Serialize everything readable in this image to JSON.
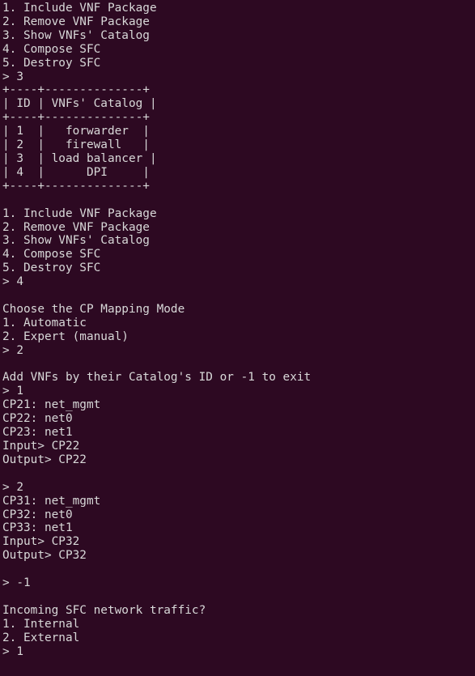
{
  "terminal": {
    "background_color": "#2d0922",
    "foreground_color": "#d8d8d8",
    "prompt_symbol": ">",
    "menu": {
      "items": [
        "1. Include VNF Package",
        "2. Remove VNF Package",
        "3. Show VNFs' Catalog",
        "4. Compose SFC",
        "5. Destroy SFC"
      ]
    },
    "catalog_table": {
      "border": "+----+--------------+",
      "header": "| ID | VNFs' Catalog |",
      "columns": [
        "ID",
        "VNFs' Catalog"
      ],
      "rows": [
        {
          "id": "1",
          "name": "forwarder"
        },
        {
          "id": "2",
          "name": "firewall"
        },
        {
          "id": "3",
          "name": "load balancer"
        },
        {
          "id": "4",
          "name": "DPI"
        }
      ]
    },
    "cp_mapping": {
      "prompt": "Choose the CP Mapping Mode",
      "options": [
        "1. Automatic",
        "2. Expert (manual)"
      ],
      "selected": "2"
    },
    "add_vnfs": {
      "prompt": "Add VNFs by their Catalog's ID or -1 to exit",
      "exit_value": "-1"
    },
    "vnf_blocks": [
      {
        "selection": "1",
        "connection_points": [
          "CP21: net_mgmt",
          "CP22: net0",
          "CP23: net1"
        ],
        "input": "Input> CP22",
        "output": "Output> CP22"
      },
      {
        "selection": "2",
        "connection_points": [
          "CP31: net_mgmt",
          "CP32: net0",
          "CP33: net1"
        ],
        "input": "Input> CP32",
        "output": "Output> CP32"
      }
    ],
    "traffic": {
      "prompt": "Incoming SFC network traffic?",
      "options": [
        "1. Internal",
        "2. External"
      ],
      "selected": "1"
    },
    "lines": [
      "1. Include VNF Package",
      "2. Remove VNF Package",
      "3. Show VNFs' Catalog",
      "4. Compose SFC",
      "5. Destroy SFC",
      "> 3",
      "+----+--------------+",
      "| ID | VNFs' Catalog |",
      "+----+--------------+",
      "| 1  |   forwarder  |",
      "| 2  |   firewall   |",
      "| 3  | load balancer |",
      "| 4  |      DPI     |",
      "+----+--------------+",
      "",
      "1. Include VNF Package",
      "2. Remove VNF Package",
      "3. Show VNFs' Catalog",
      "4. Compose SFC",
      "5. Destroy SFC",
      "> 4",
      "",
      "Choose the CP Mapping Mode",
      "1. Automatic",
      "2. Expert (manual)",
      "> 2",
      "",
      "Add VNFs by their Catalog's ID or -1 to exit",
      "> 1",
      "CP21: net_mgmt",
      "CP22: net0",
      "CP23: net1",
      "Input> CP22",
      "Output> CP22",
      "",
      "> 2",
      "CP31: net_mgmt",
      "CP32: net0",
      "CP33: net1",
      "Input> CP32",
      "Output> CP32",
      "",
      "> -1",
      "",
      "Incoming SFC network traffic?",
      "1. Internal",
      "2. External",
      "> 1"
    ]
  }
}
